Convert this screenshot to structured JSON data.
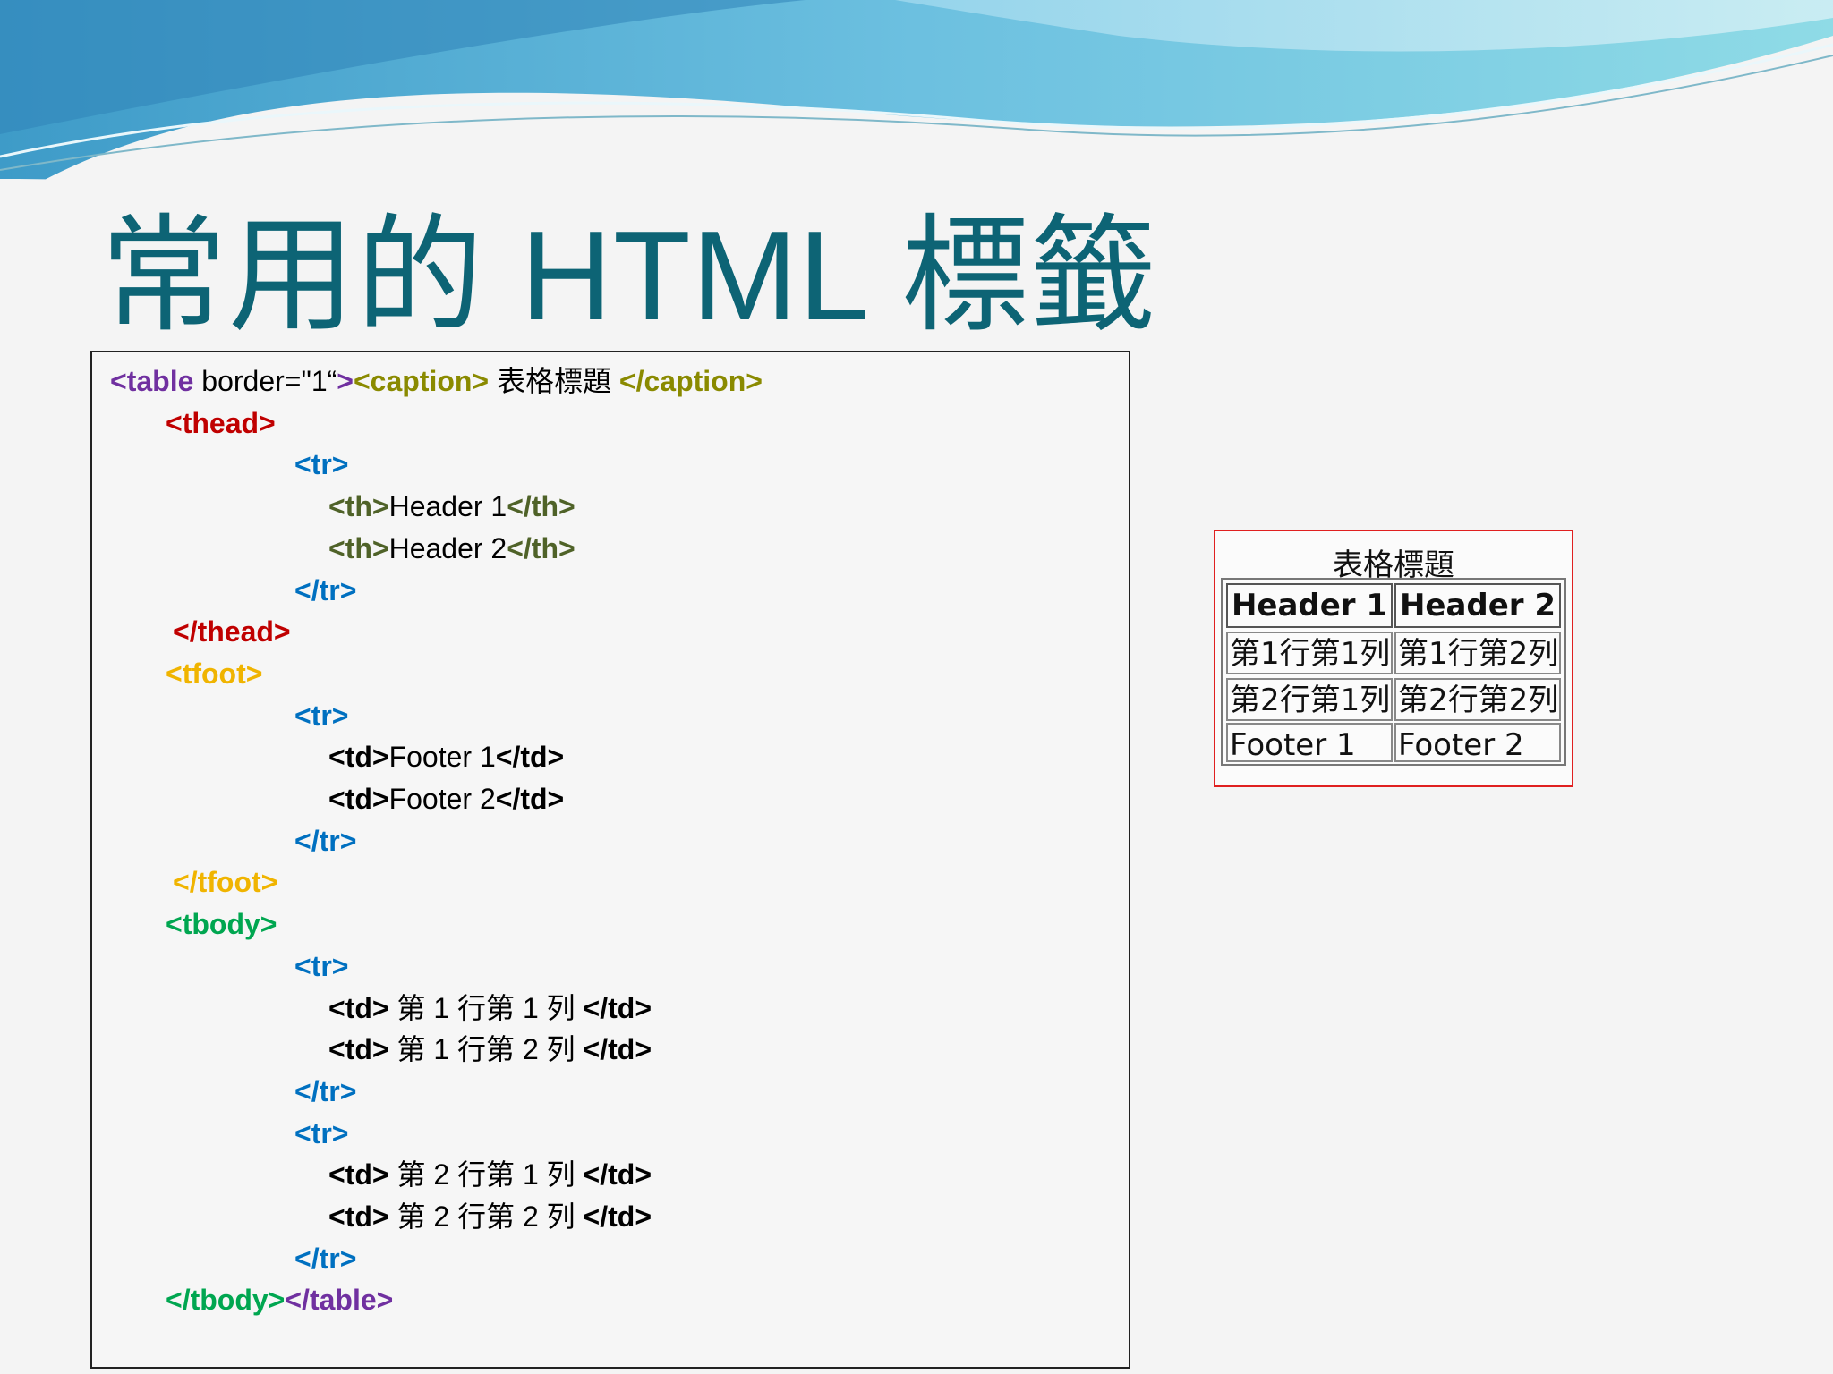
{
  "slide": {
    "title": "常用的 HTML 標籤"
  },
  "code": {
    "lines": [
      [
        {
          "text": "<table",
          "cls": "t c-purple"
        },
        {
          "text": " border=\"1“",
          "cls": "plain"
        },
        {
          "text": ">",
          "cls": "t c-purple"
        },
        {
          "text": "<caption>",
          "cls": "t c-olive"
        },
        {
          "text": " 表格標題 ",
          "cls": "plain"
        },
        {
          "text": "</caption>",
          "cls": "t c-olive"
        }
      ],
      [
        {
          "text": "<thead>",
          "cls": "t c-red"
        }
      ],
      [
        {
          "text": "<tr>",
          "cls": "t c-blue"
        }
      ],
      [
        {
          "text": "<th>",
          "cls": "t c-dkgreen"
        },
        {
          "text": "Header 1",
          "cls": "plain"
        },
        {
          "text": "</th>",
          "cls": "t c-dkgreen"
        }
      ],
      [
        {
          "text": "<th>",
          "cls": "t c-dkgreen"
        },
        {
          "text": "Header 2",
          "cls": "plain"
        },
        {
          "text": "</th>",
          "cls": "t c-dkgreen"
        }
      ],
      [
        {
          "text": "</tr>",
          "cls": "t c-blue"
        }
      ],
      [
        {
          "text": "</thead>",
          "cls": "t c-red"
        }
      ],
      [
        {
          "text": "<tfoot>",
          "cls": "t c-yellow"
        }
      ],
      [
        {
          "text": "<tr>",
          "cls": "t c-blue"
        }
      ],
      [
        {
          "text": "<td>",
          "cls": "t c-black"
        },
        {
          "text": "Footer 1",
          "cls": "plain"
        },
        {
          "text": "</td>",
          "cls": "t c-black"
        }
      ],
      [
        {
          "text": "<td>",
          "cls": "t c-black"
        },
        {
          "text": "Footer 2",
          "cls": "plain"
        },
        {
          "text": "</td>",
          "cls": "t c-black"
        }
      ],
      [
        {
          "text": "</tr>",
          "cls": "t c-blue"
        }
      ],
      [
        {
          "text": "</tfoot>",
          "cls": "t c-yellow"
        }
      ],
      [
        {
          "text": "<tbody>",
          "cls": "t c-green"
        }
      ],
      [
        {
          "text": "<tr>",
          "cls": "t c-blue"
        }
      ],
      [
        {
          "text": "<td>",
          "cls": "t c-black"
        },
        {
          "text": " 第 1 行第 1 列 ",
          "cls": "plain"
        },
        {
          "text": "</td>",
          "cls": "t c-black"
        }
      ],
      [
        {
          "text": "<td>",
          "cls": "t c-black"
        },
        {
          "text": " 第 1 行第 2 列 ",
          "cls": "plain"
        },
        {
          "text": "</td>",
          "cls": "t c-black"
        }
      ],
      [
        {
          "text": "</tr>",
          "cls": "t c-blue"
        }
      ],
      [
        {
          "text": "<tr>",
          "cls": "t c-blue"
        }
      ],
      [
        {
          "text": "<td>",
          "cls": "t c-black"
        },
        {
          "text": " 第 2 行第 1 列 ",
          "cls": "plain"
        },
        {
          "text": "</td>",
          "cls": "t c-black"
        }
      ],
      [
        {
          "text": "<td>",
          "cls": "t c-black"
        },
        {
          "text": " 第 2 行第 2 列 ",
          "cls": "plain"
        },
        {
          "text": "</td>",
          "cls": "t c-black"
        }
      ],
      [
        {
          "text": "</tr>",
          "cls": "t c-blue"
        }
      ],
      [
        {
          "text": "</tbody>",
          "cls": "t c-green"
        },
        {
          "text": "</table>",
          "cls": "t c-purple"
        }
      ]
    ]
  },
  "rendered": {
    "caption": "表格標題",
    "headers": [
      "Header 1",
      "Header 2"
    ],
    "rows": [
      [
        "第1行第1列",
        "第1行第2列"
      ],
      [
        "第2行第1列",
        "第2行第2列"
      ],
      [
        "Footer 1",
        "Footer 2"
      ]
    ]
  },
  "colors": {
    "title": "#0d6475",
    "tag_table": "#7030a0",
    "tag_caption": "#8a8a00",
    "tag_thead": "#c00000",
    "tag_tr": "#0070c0",
    "tag_th": "#4f6228",
    "tag_tfoot": "#f0b400",
    "tag_tbody": "#00a650",
    "render_border": "#e02020"
  }
}
